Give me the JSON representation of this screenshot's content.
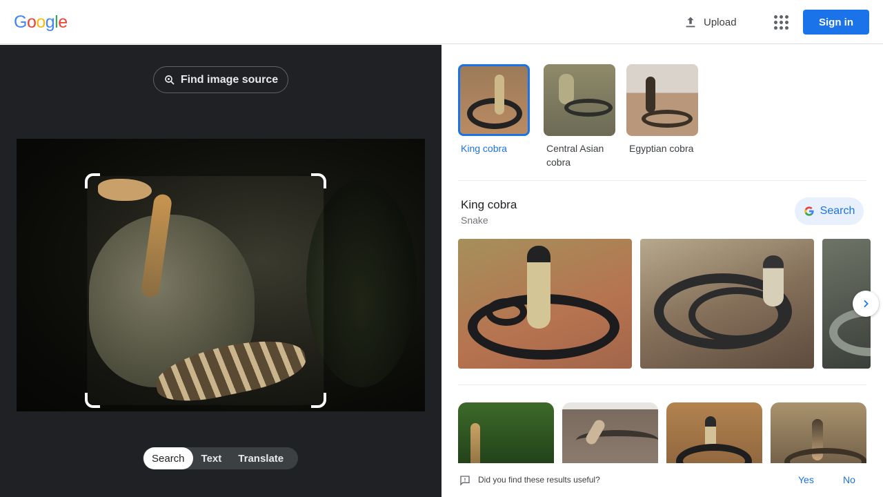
{
  "header": {
    "logo": "Google",
    "upload_label": "Upload",
    "signin_label": "Sign in"
  },
  "lens": {
    "find_source_label": "Find image source",
    "modes": [
      "Search",
      "Text",
      "Translate"
    ],
    "active_mode": "Search"
  },
  "entities": [
    {
      "label": "King cobra",
      "selected": true
    },
    {
      "label": "Central Asian cobra",
      "selected": false
    },
    {
      "label": "Egyptian cobra",
      "selected": false
    }
  ],
  "knowledge": {
    "title": "King cobra",
    "subtitle": "Snake",
    "search_label": "Search"
  },
  "feedback": {
    "question": "Did you find these results useful?",
    "yes": "Yes",
    "no": "No"
  },
  "colors": {
    "accent": "#1a73e8",
    "dark_panel": "#202124"
  }
}
